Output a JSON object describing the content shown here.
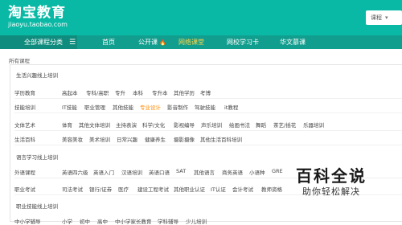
{
  "header": {
    "logo_title": "淘宝教育",
    "logo_domain": "jiaoyu.taobao.com",
    "search_scope": "课程",
    "search_chevron": "▾"
  },
  "nav": {
    "all_categories": "全部课程分类",
    "menu_glyph": "☰",
    "items": [
      {
        "label": "首页"
      },
      {
        "label": "公开课",
        "badge": "🔥"
      },
      {
        "label": "网络课堂"
      },
      {
        "label": "网校学习卡"
      },
      {
        "label": "华文慕课"
      }
    ],
    "active_color": "#ffd54a",
    "bar_color": "#129e8e",
    "header_color": "#0ab9a5"
  },
  "content": {
    "breadcrumb": "所有课程",
    "section1_title": "生活兴趣线上培训",
    "section2_title": "语言学习线上培训",
    "section3_title": "职业技能线上培训",
    "rows": [
      {
        "label": "学历教育",
        "items": [
          "高起本",
          "专科/高职",
          "专升",
          "本科",
          "专升本",
          "其他学历",
          "考博"
        ]
      },
      {
        "label": "技能培训",
        "items": [
          "IT技能",
          "职业管理",
          "其他技能",
          "专业设计",
          "影音制作",
          "驾驶技能",
          "it教程"
        ]
      },
      {
        "label": "文体艺术",
        "items": [
          "体育",
          "其他文体培训",
          "主持表演",
          "科学/文化",
          "影视编导",
          "声乐培训",
          "绘画书法",
          "舞蹈",
          "茶艺/插花",
          "乐器培训"
        ]
      },
      {
        "label": "生活百科",
        "items": [
          "美容美妆",
          "美术培训",
          "日常兴趣",
          "健康养生",
          "摄影摄像",
          "其他生活百科培训"
        ]
      },
      {
        "label": "外语课程",
        "items": [
          "英语四六级",
          "英语入门",
          "汉语培训",
          "英语口语",
          "SAT",
          "其他语言",
          "商务英语",
          "小语种",
          "GRE"
        ]
      },
      {
        "label": "职业考试",
        "items": [
          "司法考试",
          "银行/证券",
          "医疗",
          "建设工程考试",
          "其他职业认证",
          "IT认证",
          "会计考试",
          "教师资格"
        ]
      },
      {
        "label": "中小学辅导",
        "items": [
          "小学",
          "初中",
          "高中",
          "中小学家长教育",
          "学科辅导",
          "少儿培训"
        ]
      }
    ],
    "highlight_color": "#ff8a00"
  },
  "watermark": {
    "title": "百科全说",
    "subtitle": "助你轻松解决"
  }
}
